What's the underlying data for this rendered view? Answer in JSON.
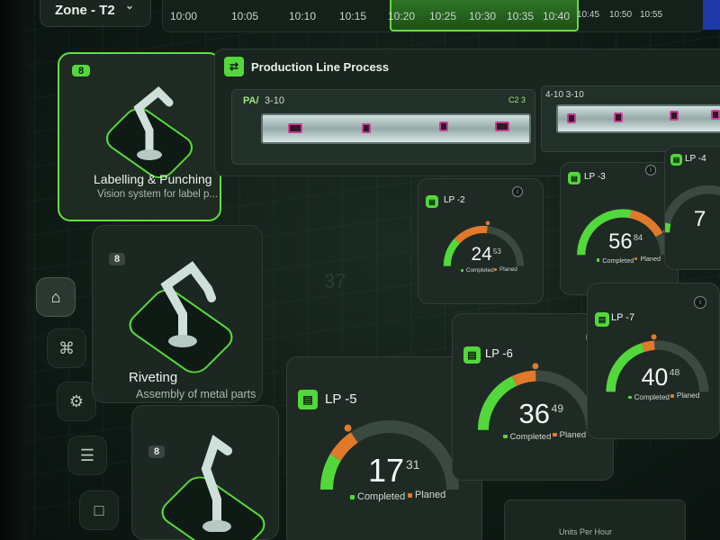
{
  "header": {
    "zone": "Zone - T2",
    "times": [
      "10:00",
      "10:05",
      "10:10",
      "10:15",
      "10:20",
      "10:25",
      "10:30",
      "10:35",
      "10:40",
      "10:45",
      "10:50",
      "10:55"
    ]
  },
  "sidebar": {
    "items": [
      {
        "icon": "home-icon",
        "active": true
      },
      {
        "icon": "grid-icon",
        "active": false
      },
      {
        "icon": "robot-arm-icon",
        "active": false
      },
      {
        "icon": "filter-settings-icon",
        "active": false
      },
      {
        "icon": "crop-icon",
        "active": false
      }
    ]
  },
  "stations": [
    {
      "badge": "8",
      "title": "Labelling & Punching",
      "subtitle": "Vision system for label p..."
    },
    {
      "badge": "8",
      "title": "Riveting",
      "subtitle": "Assembly of metal parts"
    },
    {
      "badge": "8",
      "title": "",
      "subtitle": ""
    }
  ],
  "process": {
    "title": "Production Line Process",
    "lane1": {
      "prefix": "PA/",
      "range": "3-10",
      "codes": "C2  3"
    },
    "lane2": {
      "range": "4-10 3-10"
    }
  },
  "legend": {
    "completed": "Completed",
    "planned": "Planed"
  },
  "gauges": [
    {
      "name": "LP -2",
      "completed": 24,
      "planned": 53
    },
    {
      "name": "LP -3",
      "completed": 56,
      "planned": 84
    },
    {
      "name": "LP -4",
      "completed": 7,
      "planned": null
    },
    {
      "name": "LP -5",
      "completed": 17,
      "planned": 31
    },
    {
      "name": "LP -6",
      "completed": 36,
      "planned": 49
    },
    {
      "name": "LP -7",
      "completed": 40,
      "planned": 48
    }
  ],
  "faded_value": "37",
  "bottom": {
    "label": "Units Per Hour"
  },
  "colors": {
    "accent": "#52d83a",
    "planned": "#e07a2a",
    "background": "#0f1a15"
  }
}
